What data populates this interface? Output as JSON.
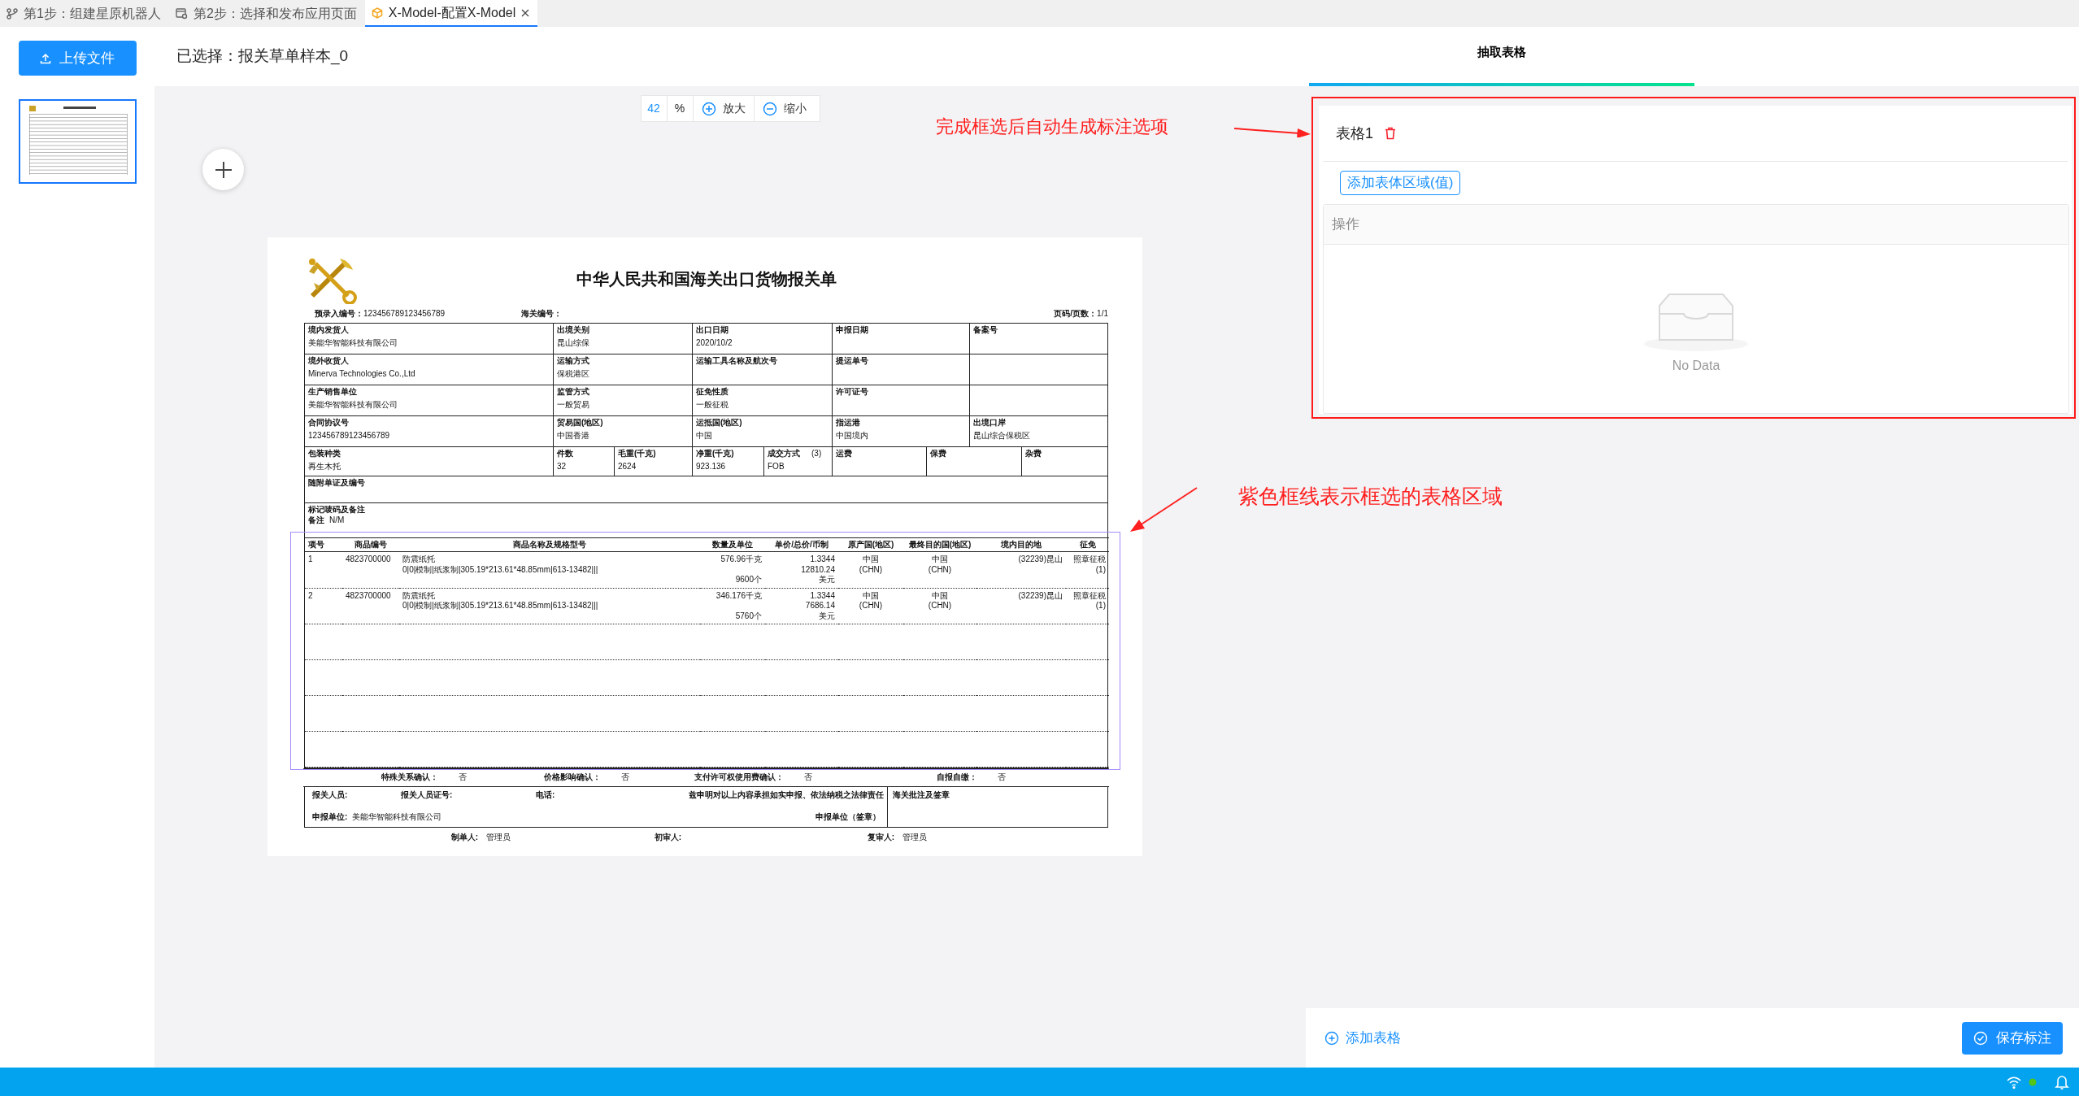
{
  "tabs": [
    {
      "label": "第1步：组建星原机器人",
      "kind": "branch",
      "selected": false,
      "closable": false
    },
    {
      "label": "第2步：选择和发布应用页面",
      "kind": "app",
      "selected": false,
      "closable": false
    },
    {
      "label": "X-Model-配置X-Model",
      "kind": "cube",
      "selected": true,
      "closable": true
    }
  ],
  "upload_button": "上传文件",
  "selected_file": "已选择：报关草单样本_0",
  "zoom": {
    "value": "42",
    "unit": "%",
    "zoom_in": "放大",
    "zoom_out": "缩小"
  },
  "document": {
    "title": "中华人民共和国海关出口货物报关单",
    "header": [
      {
        "label": "预录入编号：",
        "value": "123456789123456789"
      },
      {
        "label": "海关编号："
      },
      {
        "label": "页码/页数：",
        "value": "1/1"
      }
    ],
    "form_rows": [
      {
        "kind": "five",
        "cells": [
          {
            "label": "境内发货人",
            "value": "美能华智能科技有限公司"
          },
          {
            "label": "出境关别",
            "value": "昆山综保"
          },
          {
            "label": "出口日期",
            "value": "2020/10/2"
          },
          {
            "label": "申报日期"
          },
          {
            "label": "备案号"
          }
        ]
      },
      {
        "kind": "five",
        "cells": [
          {
            "label": "境外收货人",
            "value": "Minerva Technologies Co.,Ltd"
          },
          {
            "label": "运输方式",
            "value": "保税港区"
          },
          {
            "label": "运输工具名称及航次号"
          },
          {
            "label": "提运单号"
          }
        ]
      },
      {
        "kind": "five",
        "cells": [
          {
            "label": "生产销售单位",
            "value": "美能华智能科技有限公司"
          },
          {
            "label": "监管方式",
            "value": "一般贸易"
          },
          {
            "label": "征免性质",
            "value": "一般征税"
          },
          {
            "label": "许可证号"
          }
        ]
      },
      {
        "kind": "five",
        "cells": [
          {
            "label": "合同协议号",
            "value": "123456789123456789"
          },
          {
            "label": "贸易国(地区)",
            "value": "中国香港"
          },
          {
            "label": "运抵国(地区)",
            "value": "中国"
          },
          {
            "label": "指运港",
            "value": "中国境内"
          },
          {
            "label": "出境口岸",
            "value": "昆山综合保税区"
          }
        ]
      },
      {
        "kind": "eight",
        "cells": [
          {
            "label": "包装种类",
            "value": "再生木托"
          },
          {
            "label": "件数",
            "value": "32"
          },
          {
            "label": "毛重(千克)",
            "value": "2624"
          },
          {
            "label": "净重(千克)",
            "value": "923.136"
          },
          {
            "label": "成交方式",
            "code": "(3)",
            "value": "FOB"
          },
          {
            "label": "运费"
          },
          {
            "label": "保费"
          },
          {
            "label": "杂费"
          }
        ]
      },
      {
        "kind": "full",
        "cells": [
          {
            "label": "随附单证及编号"
          }
        ]
      },
      {
        "kind": "remarks",
        "cells": [
          {
            "label": "标记唛码及备注",
            "note_label": "备注",
            "note": "N/M"
          }
        ]
      }
    ],
    "goods": {
      "columns": [
        "项号",
        "商品编号",
        "商品名称及规格型号",
        "数量及单位",
        "单价/总价/币制",
        "原产国(地区)",
        "最终目的国(地区)",
        "境内目的地",
        "征免"
      ],
      "rows": [
        [
          "1",
          "4823700000",
          "防震纸托\n0|0|模制|纸浆制|305.19*213.61*48.85mm|613-13482|||",
          "576.96千克\n\n9600个",
          "1.3344\n12810.24\n美元",
          "中国\n(CHN)",
          "中国\n(CHN)",
          "(32239)昆山",
          "照章征税\n(1)"
        ],
        [
          "2",
          "4823700000",
          "防震纸托\n0|0|模制|纸浆制|305.19*213.61*48.85mm|613-13482|||",
          "346.176千克\n\n5760个",
          "1.3344\n7686.14\n美元",
          "中国\n(CHN)",
          "中国\n(CHN)",
          "(32239)昆山",
          "照章征税\n(1)"
        ]
      ]
    },
    "confirmations": [
      {
        "label": "特殊关系确认：",
        "value": "否"
      },
      {
        "label": "价格影响确认：",
        "value": "否"
      },
      {
        "label": "支付许可权使用费确认：",
        "value": "否"
      },
      {
        "label": "自报自缴：",
        "value": "否"
      }
    ],
    "declaration": {
      "fields": [
        "报关人员:",
        "报关人员证号:",
        "电话:"
      ],
      "statement": "兹申明对以上内容承担如实申报、依法纳税之法律责任",
      "unit_label": "申报单位:",
      "unit_value": "美能华智能科技有限公司",
      "seal": "申报单位（签章）",
      "customs": "海关批注及签章"
    },
    "signatures": [
      {
        "label": "制单人:",
        "value": "管理员"
      },
      {
        "label": "初审人:"
      },
      {
        "label": "复审人:",
        "value": "管理员"
      }
    ]
  },
  "annotations": [
    {
      "text": "完成框选后自动生成标注选项"
    },
    {
      "text": "紫色框线表示框选的表格区域"
    }
  ],
  "right_panel": {
    "tab": "抽取表格",
    "table_name": "表格1",
    "add_region_button": "添加表体区域(值)",
    "column_header": "操作",
    "empty_text": "No Data",
    "add_table": "添加表格",
    "save_button": "保存标注"
  }
}
